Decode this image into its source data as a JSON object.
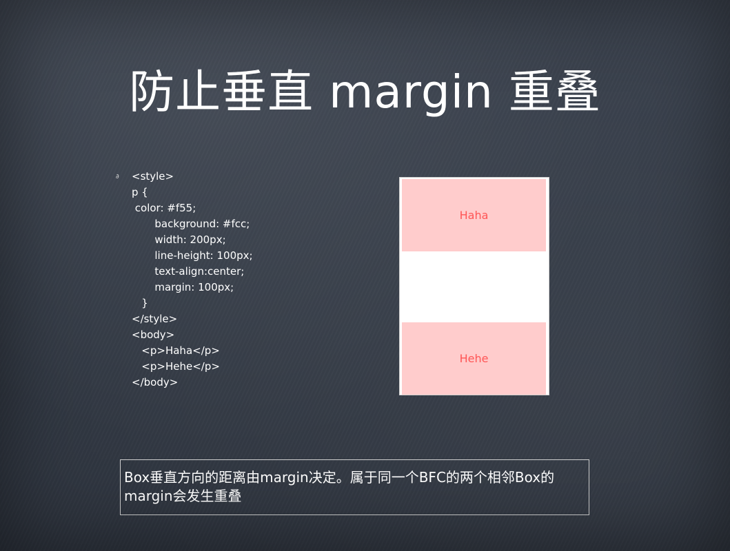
{
  "slide": {
    "title": "防止垂直 margin 重叠",
    "bullet_symbol": "∂",
    "code_lines": [
      "<style>",
      "p {",
      " color: #f55;",
      "       background: #fcc;",
      "       width: 200px;",
      "       line-height: 100px;",
      "       text-align:center;",
      "       margin: 100px;",
      "   }",
      "</style>",
      "<body>",
      "   <p>Haha</p>",
      "   <p>Hehe</p>",
      "</body>"
    ],
    "demo": {
      "p1_text": "Haha",
      "p2_text": "Hehe",
      "p_background": "#ffcccc",
      "p_color": "#ff5555"
    },
    "note_text": "Box垂直方向的距离由margin决定。属于同一个BFC的两个相邻Box的margin会发生重叠"
  },
  "colors": {
    "background": "#363d48",
    "text": "#ffffff",
    "demo_box": "#ffffff"
  }
}
